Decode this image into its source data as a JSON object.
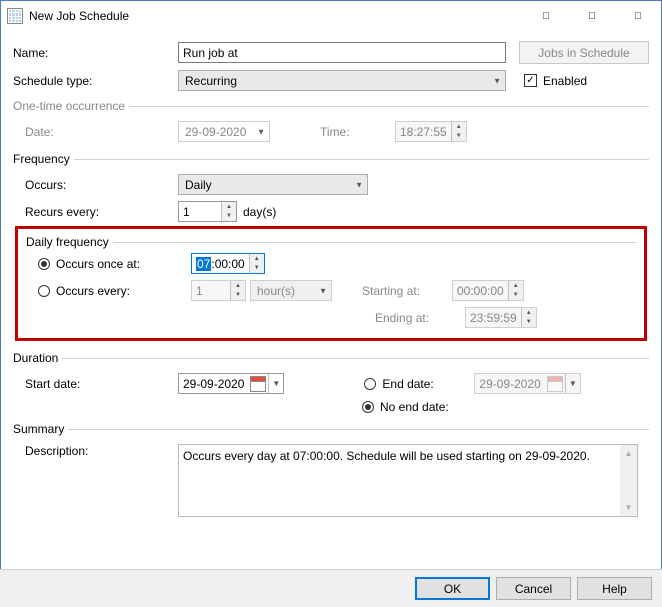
{
  "window": {
    "title": "New Job Schedule"
  },
  "header": {
    "name_label": "Name:",
    "name_value": "Run job at",
    "jobs_button": "Jobs in Schedule",
    "type_label": "Schedule type:",
    "type_value": "Recurring",
    "enabled_label": "Enabled",
    "enabled_checked": true
  },
  "onetime": {
    "legend": "One-time occurrence",
    "date_label": "Date:",
    "date_value": "29-09-2020",
    "time_label": "Time:",
    "time_value": "18:27:55"
  },
  "frequency": {
    "legend": "Frequency",
    "occurs_label": "Occurs:",
    "occurs_value": "Daily",
    "recurs_label": "Recurs every:",
    "recurs_value": "1",
    "recurs_unit": "day(s)"
  },
  "daily": {
    "legend": "Daily frequency",
    "once_label": "Occurs once at:",
    "once_selected": true,
    "once_hh": "07",
    "once_rest": ":00:00",
    "every_label": "Occurs every:",
    "every_value": "1",
    "every_unit": "hour(s)",
    "starting_label": "Starting at:",
    "starting_value": "00:00:00",
    "ending_label": "Ending at:",
    "ending_value": "23:59:59"
  },
  "duration": {
    "legend": "Duration",
    "start_label": "Start date:",
    "start_value": "29-09-2020",
    "end_label": "End date:",
    "end_value": "29-09-2020",
    "noend_label": "No end date:",
    "noend_selected": true
  },
  "summary": {
    "legend": "Summary",
    "desc_label": "Description:",
    "desc_value": "Occurs every day at 07:00:00. Schedule will be used starting on 29-09-2020."
  },
  "buttons": {
    "ok": "OK",
    "cancel": "Cancel",
    "help": "Help"
  }
}
